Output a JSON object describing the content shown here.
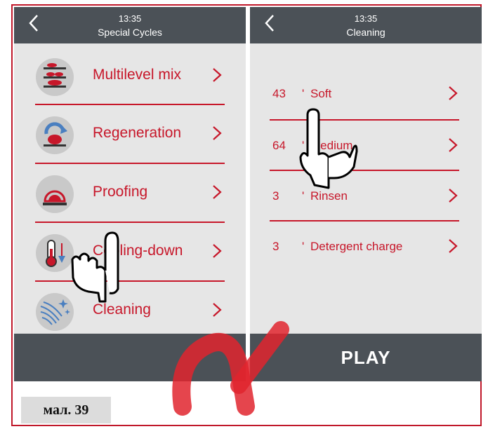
{
  "caption": "мал. 39",
  "left_panel": {
    "time": "13:35",
    "title": "Special Cycles",
    "items": [
      {
        "label": "Multilevel mix",
        "icon": "multilevel-mix-icon"
      },
      {
        "label": "Regeneration",
        "icon": "regeneration-icon"
      },
      {
        "label": "Proofing",
        "icon": "proofing-icon"
      },
      {
        "label": "Cooling-down",
        "icon": "thermometer-icon"
      },
      {
        "label": "Cleaning",
        "icon": "cleaning-icon"
      }
    ]
  },
  "right_panel": {
    "time": "13:35",
    "title": "Cleaning",
    "play_label": "PLAY",
    "items": [
      {
        "value": "43",
        "unit": "'",
        "label": "Soft"
      },
      {
        "value": "64",
        "unit": "'",
        "label": "Medium"
      },
      {
        "value": "3",
        "unit": "'",
        "label": "Rinsen"
      },
      {
        "value": "3",
        "unit": "'",
        "label": "Detergent charge"
      }
    ]
  },
  "colors": {
    "accent": "#c7172a",
    "header": "#4b5157",
    "panel": "#e6e6e6"
  }
}
